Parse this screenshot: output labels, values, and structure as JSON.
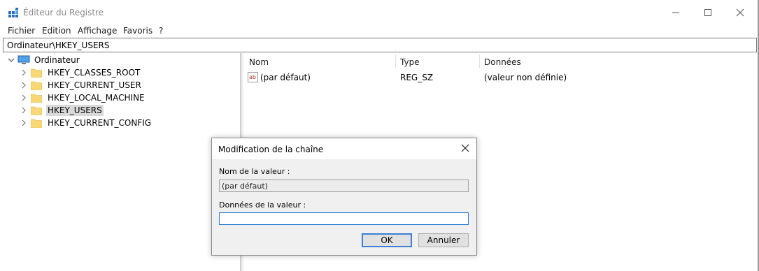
{
  "window": {
    "title": "Éditeur du Registre",
    "controls": {
      "minimize": "—",
      "maximize": "☐",
      "close": "✕"
    }
  },
  "menu": [
    "Fichier",
    "Edition",
    "Affichage",
    "Favoris",
    "?"
  ],
  "address": "Ordinateur\\HKEY_USERS",
  "tree": {
    "root": {
      "label": "Ordinateur",
      "expanded": true
    },
    "items": [
      {
        "label": "HKEY_CLASSES_ROOT",
        "selected": false
      },
      {
        "label": "HKEY_CURRENT_USER",
        "selected": false
      },
      {
        "label": "HKEY_LOCAL_MACHINE",
        "selected": false
      },
      {
        "label": "HKEY_USERS",
        "selected": true
      },
      {
        "label": "HKEY_CURRENT_CONFIG",
        "selected": false
      }
    ]
  },
  "list": {
    "columns": [
      "Nom",
      "Type",
      "Données"
    ],
    "rows": [
      {
        "icon": "string-value-icon",
        "name": "(par défaut)",
        "type": "REG_SZ",
        "data": "(valeur non définie)"
      }
    ]
  },
  "dialog": {
    "title": "Modification de la chaîne",
    "close": "✕",
    "name_label": "Nom de la valeur :",
    "name_value": "(par défaut)",
    "data_label": "Données de la valeur :",
    "data_value": "",
    "ok_label": "OK",
    "cancel_label": "Annuler"
  },
  "icons": {
    "app": "registry-editor-icon",
    "computer": "computer-icon",
    "folder": "folder-icon",
    "chevron_right": "›",
    "chevron_down": "⌄"
  },
  "colors": {
    "folder": "#f8d775",
    "selection": "#d9d9d9",
    "focus_border": "#2b7bd1",
    "title_gray": "#8a8a8a"
  }
}
